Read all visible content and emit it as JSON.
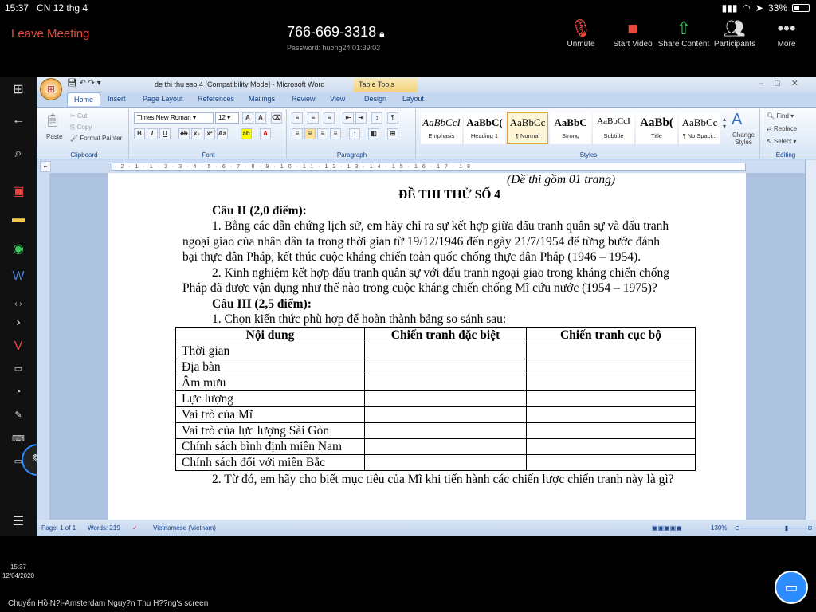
{
  "ios": {
    "time": "15:37",
    "date": "CN 12 thg 4",
    "battery": "33%"
  },
  "zoom": {
    "leave": "Leave Meeting",
    "meeting_id": "766-669-3318",
    "password": "Password: huong24   01:39:03",
    "buttons": [
      "Unmute",
      "Start Video",
      "Share Content",
      "Participants",
      "More"
    ]
  },
  "taskbar": {
    "clock_time": "15:37",
    "clock_date": "12/04/2020"
  },
  "word": {
    "title": "de thi thu sso 4 [Compatibility Mode] - Microsoft Word",
    "table_tools": "Table Tools",
    "tabs": [
      "Home",
      "Insert",
      "Page Layout",
      "References",
      "Mailings",
      "Review",
      "View",
      "Design",
      "Layout"
    ],
    "clipboard": {
      "paste": "Paste",
      "cut": "Cut",
      "copy": "Copy",
      "format_painter": "Format Painter",
      "label": "Clipboard"
    },
    "font": {
      "name": "Times New Roman",
      "size": "12",
      "label": "Font"
    },
    "paragraph_label": "Paragraph",
    "styles": [
      {
        "preview": "AaBbCcI",
        "name": "Emphasis"
      },
      {
        "preview": "AaBbC(",
        "name": "Heading 1"
      },
      {
        "preview": "AaBbCc",
        "name": "¶ Normal"
      },
      {
        "preview": "AaBbC",
        "name": "Strong"
      },
      {
        "preview": "AaBbCcI",
        "name": "Subtitle"
      },
      {
        "preview": "AaBb(",
        "name": "Title"
      },
      {
        "preview": "AaBbCc",
        "name": "¶ No Spaci..."
      }
    ],
    "styles_label": "Styles",
    "change_styles": "Change Styles",
    "editing": {
      "find": "Find",
      "replace": "Replace",
      "select": "Select",
      "label": "Editing"
    },
    "status": {
      "page": "Page: 1 of 1",
      "words": "Words: 219",
      "language": "Vietnamese (Vietnam)",
      "zoom": "130%"
    }
  },
  "doc": {
    "line0": "(Đề thi gồm 01 trang)",
    "heading": "ĐỀ THI THỬ SỐ 4",
    "q2": "Câu II (2,0 điểm):",
    "p1a": "1. Bằng các dẫn chứng lịch sử, em hãy chỉ ra sự kết hợp giữa đấu tranh quân sự và đấu tranh",
    "p1b": "ngoại giao của nhân dân ta trong thời gian từ 19/12/1946 đến ngày 21/7/1954 để từng bước đánh",
    "p1c": "bại thực dân Pháp, kết thúc cuộc kháng chiến toàn quốc chống thực dân Pháp (1946 – 1954).",
    "p2a": "2. Kinh nghiệm kết hợp đấu tranh quân sự với đấu tranh ngoại giao trong kháng chiến chống",
    "p2b": "Pháp đã được vận dụng như thế nào trong cuộc kháng chiến chống Mĩ cứu nước (1954 – 1975)?",
    "q3": "Câu III (2,5 điểm):",
    "q3_1": "1. Chọn kiến thức phù hợp để hoàn thành bảng so sánh sau:",
    "table_headers": [
      "Nội dung",
      "Chiến tranh đặc biệt",
      "Chiến tranh cục bộ"
    ],
    "table_rows": [
      "Thời gian",
      "Địa bàn",
      "Âm mưu",
      "Lực lượng",
      "Vai trò của Mĩ",
      "Vai trò của lực lượng Sài Gòn",
      "Chính sách bình định miền Nam",
      "Chính sách đối với miền Bắc"
    ],
    "q3_2": "2. Từ đó, em hãy cho biết mục tiêu của Mĩ khi tiến hành các chiến lược chiến tranh này là gì?"
  },
  "footer": "Chuyển Hồ N?i-Amsterdam Nguy?n Thu H??ng's screen"
}
